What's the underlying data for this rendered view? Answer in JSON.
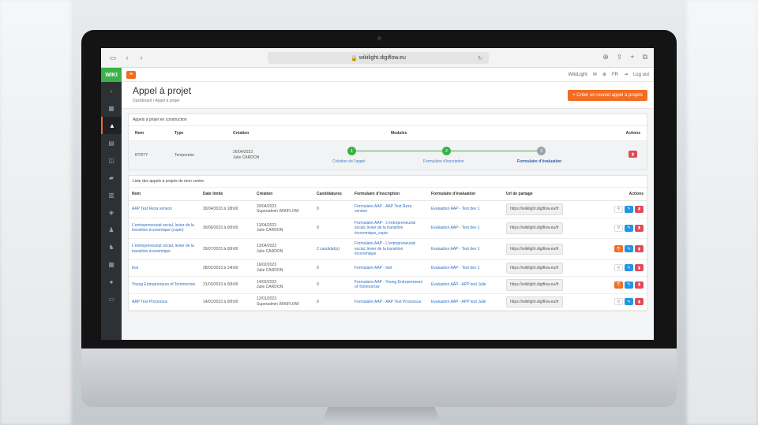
{
  "browser": {
    "url": "wikilight.digiflow.eu"
  },
  "app": {
    "logo": "WIKI"
  },
  "topbar": {
    "site": "WikiLight",
    "lang": "FR",
    "logout": "Log out"
  },
  "page": {
    "title": "Appel à projet",
    "breadcrumb": "Dashboard  /  Appel à projet",
    "create_button": "Créer un nouvel appel à projets"
  },
  "construction": {
    "title": "Appels à projet en construction",
    "headers": {
      "name": "Nom",
      "type": "Type",
      "created": "Création",
      "modules": "Modules",
      "actions": "Actions"
    },
    "row": {
      "name": "RTRTY",
      "type": "Temporaire",
      "date": "26/04/2023",
      "author": "Julie CARDON"
    },
    "steps": [
      {
        "num": "1",
        "label": "Création de l'appel"
      },
      {
        "num": "2",
        "label": "Formulaire d'inscription"
      },
      {
        "num": "3",
        "label": "Formulaire d'évaluation"
      }
    ]
  },
  "list": {
    "title": "Liste des appels à projets de mon centre",
    "headers": [
      "Nom",
      "Date limite",
      "Création",
      "Candidatures",
      "Formulaire d'inscription",
      "Formulaire d'évaluation",
      "Url de partage",
      "Actions"
    ],
    "rows": [
      {
        "name": "AAP Test Reza version",
        "deadline": "30/04/2023 à 18h00",
        "created": "20/04/2023",
        "author": "Superadmin WIKIFLOW",
        "cands": "0",
        "form": "Formulaire AAP - AAP Test Reza version",
        "eval": "Evaluation AAP - Test dev 1",
        "url": "https://wikilight.digiflow.eu/fr",
        "first": "o"
      },
      {
        "name": "L'entrepreneuriat social, levier de la transition économique (copie)",
        "deadline": "30/06/2023 à 00h00",
        "created": "13/04/2023",
        "author": "Julie CARDON",
        "cands": "0",
        "form": "Formulaire AAP - L'entrepreneuriat social, levier de la transition économique_copie",
        "eval": "Evaluation AAP - Test dev 1",
        "url": "https://wikilight.digiflow.eu/fr",
        "first": "o"
      },
      {
        "name": "L'entrepreneuriat social, levier de la transition économique",
        "deadline": "29/07/2023 à 00h00",
        "created": "13/04/2023",
        "author": "Julie CARDON",
        "cands": "2 candidat(s)",
        "form": "Formulaire AAP - L'entrepreneuriat social, levier de la transition économique",
        "eval": "Evaluation AAP - Test dev 1",
        "url": "https://wikilight.digiflow.eu/fr",
        "first": "or"
      },
      {
        "name": "test",
        "deadline": "28/02/2023 à 14h00",
        "created": "16/02/2023",
        "author": "Julie CARDON",
        "cands": "0",
        "form": "Formulaire AAP - test",
        "eval": "Evaluation AAP - Test dev 1",
        "url": "https://wikilight.digiflow.eu/fr",
        "first": "o"
      },
      {
        "name": "Young Entrepreneurs of Tommorrow",
        "deadline": "31/03/2023 à 00h00",
        "created": "14/02/2023",
        "author": "Julie CARDON",
        "cands": "0",
        "form": "Formulaire AAP - Young Entrepreneurs of Tommorrow",
        "eval": "Evaluation AAP - APP test Julie",
        "url": "https://wikilight.digiflow.eu/fr",
        "first": "or"
      },
      {
        "name": "AAP Test Processus",
        "deadline": "14/01/2023 à 00h00",
        "created": "12/01/2023",
        "author": "Superadmin WIKIFLOW",
        "cands": "0",
        "form": "Formulaire AAP - AAP Test Processus",
        "eval": "Evaluation AAP - APP test Julie",
        "url": "https://wikilight.digiflow.eu/fr",
        "first": "o"
      }
    ]
  }
}
